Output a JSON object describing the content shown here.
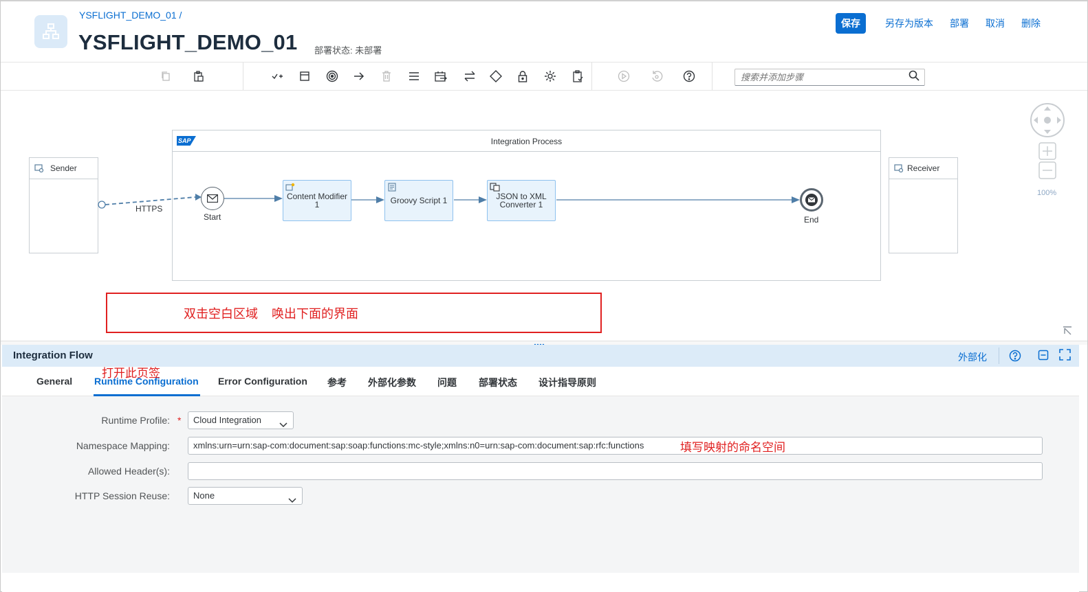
{
  "header": {
    "breadcrumb": "YSFLIGHT_DEMO_01 /",
    "title": "YSFLIGHT_DEMO_01",
    "deploy_status": "部署状态: 未部署",
    "actions": {
      "save": "保存",
      "save_as_version": "另存为版本",
      "deploy": "部署",
      "cancel": "取消",
      "delete": "删除"
    }
  },
  "toolbar": {
    "icons": [
      "copy-icon",
      "paste-icon",
      "participants-icon",
      "process-icon",
      "events-icon",
      "connector-icon",
      "delete-icon",
      "routing-icon",
      "call-icon",
      "transformation-icon",
      "gateway-icon",
      "security-icon",
      "persistence-icon",
      "validator-icon",
      "simulation-icon",
      "undo-icon",
      "help-icon"
    ],
    "search_placeholder": "搜索并添加步骤"
  },
  "canvas": {
    "sender": "Sender",
    "receiver": "Receiver",
    "process_title": "Integration Process",
    "sap_logo": "SAP",
    "adapter": "HTTPS",
    "start": "Start",
    "end": "End",
    "steps": [
      "Content Modifier 1",
      "Groovy Script 1",
      "JSON to XML Converter 1"
    ],
    "steps_display": {
      "content_modifier_l1": "Content Modifier",
      "content_modifier_l2": "1",
      "groovy": "Groovy Script 1",
      "json_l1": "JSON to XML",
      "json_l2": "Converter 1"
    },
    "zoom": "100%",
    "annotation": "双击空白区域    唤出下面的界面"
  },
  "properties": {
    "title": "Integration Flow",
    "externalize": "外部化",
    "tab_note": "打开此页签",
    "tabs": [
      "General",
      "Runtime Configuration",
      "Error Configuration",
      "参考",
      "外部化参数",
      "问题",
      "部署状态",
      "设计指导原则"
    ],
    "active_tab": "Runtime Configuration",
    "fields": {
      "runtime_profile_label": "Runtime Profile:",
      "runtime_profile_value": "Cloud Integration",
      "namespace_label": "Namespace Mapping:",
      "namespace_value": "xmlns:urn=urn:sap-com:document:sap:soap:functions:mc-style;xmlns:n0=urn:sap-com:document:sap:rfc:functions",
      "namespace_note": "填写映射的命名空间",
      "allowed_headers_label": "Allowed Header(s):",
      "allowed_headers_value": "",
      "session_reuse_label": "HTTP Session Reuse:",
      "session_reuse_value": "None"
    }
  },
  "colors": {
    "accent": "#0a6ed1",
    "annotation": "#e02020",
    "panel_header": "#dcebf8",
    "step_fill": "#e8f3fc"
  }
}
